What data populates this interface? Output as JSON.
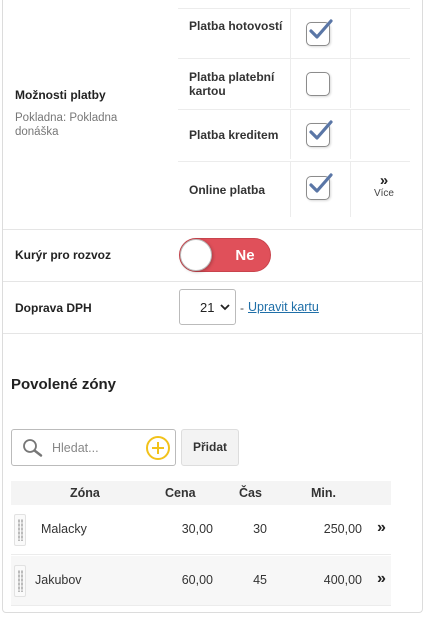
{
  "payment": {
    "label": "Možnosti platby",
    "sublabel": "Pokladna: Pokladna donáška",
    "options": [
      {
        "name": "Platba hotovostí",
        "checked": true
      },
      {
        "name": "Platba platební kartou",
        "checked": false
      },
      {
        "name": "Platba kreditem",
        "checked": true
      },
      {
        "name": "Online platba",
        "checked": true
      }
    ],
    "more_label": "Více",
    "more_icon": "double-chevron-right-icon"
  },
  "courier": {
    "label": "Kurýr pro rozvoz",
    "toggle_text": "Ne",
    "toggle_color": "#e0505a"
  },
  "vat": {
    "label": "Doprava DPH",
    "selected": "21",
    "separator": "-",
    "edit_link": "Upravit kartu",
    "link_color": "#1f6fa8"
  },
  "zones": {
    "title": "Povolené zóny",
    "search_placeholder": "Hledat...",
    "add_button": "Přidat",
    "plus_color": "#f2c21a",
    "columns": [
      "Zóna",
      "Cena",
      "Čas",
      "Min."
    ],
    "rows": [
      {
        "zone": "Malacky",
        "price": "30,00",
        "time": "30",
        "min": "250,00"
      },
      {
        "zone": "Jakubov",
        "price": "60,00",
        "time": "45",
        "min": "400,00"
      }
    ]
  },
  "colors": {
    "checkmark": "#5a76a6"
  }
}
